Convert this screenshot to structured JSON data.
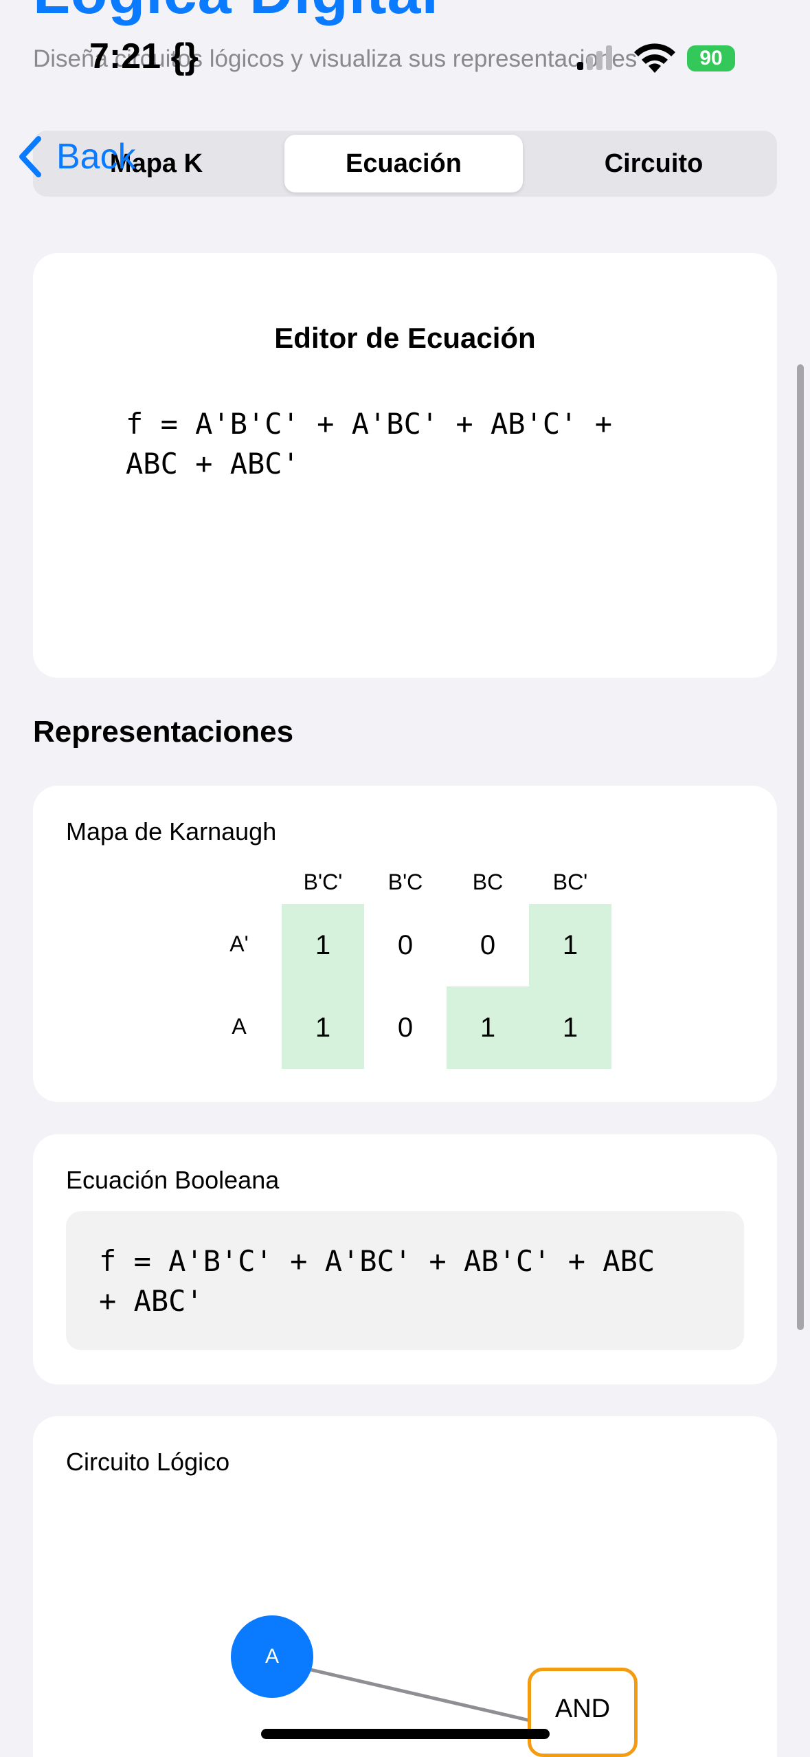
{
  "header": {
    "large_title": "Lógica Digital",
    "subtitle": "Diseña circuitos lógicos y visualiza sus representaciones"
  },
  "status_bar": {
    "time": "7:21",
    "time_icon": "{}",
    "battery": "90"
  },
  "nav": {
    "back_label": "Back"
  },
  "segments": [
    {
      "label": "Mapa K",
      "selected": false
    },
    {
      "label": "Ecuación",
      "selected": true
    },
    {
      "label": "Circuito",
      "selected": false
    }
  ],
  "editor": {
    "title": "Editor de Ecuación",
    "equation_line1": "f = A'B'C' + A'BC' + AB'C' +",
    "equation_line2": "ABC + ABC'"
  },
  "representations": {
    "section_title": "Representaciones",
    "kmap": {
      "label": "Mapa de Karnaugh",
      "col_headers": [
        "B'C'",
        "B'C",
        "BC",
        "BC'"
      ],
      "row_headers": [
        "A'",
        "A"
      ],
      "cells": [
        [
          "1",
          "0",
          "0",
          "1"
        ],
        [
          "1",
          "0",
          "1",
          "1"
        ]
      ]
    },
    "boolean": {
      "label": "Ecuación Booleana",
      "line1": "f = A'B'C' + A'BC' + AB'C' + ABC",
      "line2": "+ ABC'"
    },
    "circuit": {
      "label": "Circuito Lógico",
      "node_a": "A",
      "gate": "AND"
    }
  },
  "colors": {
    "accent": "#0a7aff",
    "highlight": "#d6f2dc",
    "gate_border": "#f39c12",
    "battery": "#34c759"
  }
}
